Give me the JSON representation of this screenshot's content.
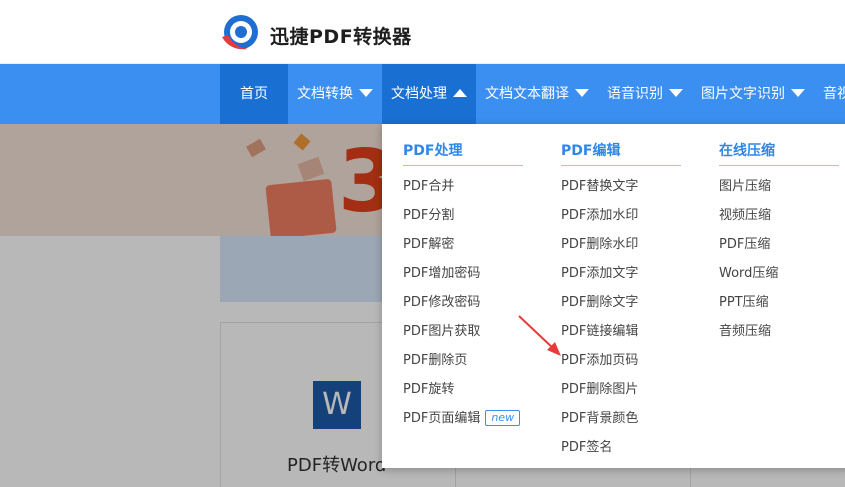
{
  "header": {
    "brand": "迅捷PDF转换器"
  },
  "nav": {
    "items": [
      {
        "label": "首页"
      },
      {
        "label": "文档转换"
      },
      {
        "label": "文档处理"
      },
      {
        "label": "文档文本翻译"
      },
      {
        "label": "语音识别"
      },
      {
        "label": "图片文字识别"
      },
      {
        "label": "音视"
      }
    ]
  },
  "background": {
    "banner_text": "3",
    "card_title": "PDF转Word",
    "card_icon_letter": "W"
  },
  "dropdown": {
    "columns": [
      {
        "title": "PDF处理",
        "links": [
          "PDF合并",
          "PDF分割",
          "PDF解密",
          "PDF增加密码",
          "PDF修改密码",
          "PDF图片获取",
          "PDF删除页",
          "PDF旋转",
          "PDF页面编辑"
        ],
        "new_badge": "new"
      },
      {
        "title": "PDF编辑",
        "links": [
          "PDF替换文字",
          "PDF添加水印",
          "PDF删除水印",
          "PDF添加文字",
          "PDF删除文字",
          "PDF链接编辑",
          "PDF添加页码",
          "PDF删除图片",
          "PDF背景颜色",
          "PDF签名"
        ]
      },
      {
        "title": "在线压缩",
        "links": [
          "图片压缩",
          "视频压缩",
          "PDF压缩",
          "Word压缩",
          "PPT压缩",
          "音频压缩"
        ]
      }
    ]
  },
  "colors": {
    "nav_bg": "#3b8ff0",
    "nav_active": "#1a6fd3",
    "accent": "#2f87e8",
    "annotation_arrow": "#e83a3a"
  }
}
